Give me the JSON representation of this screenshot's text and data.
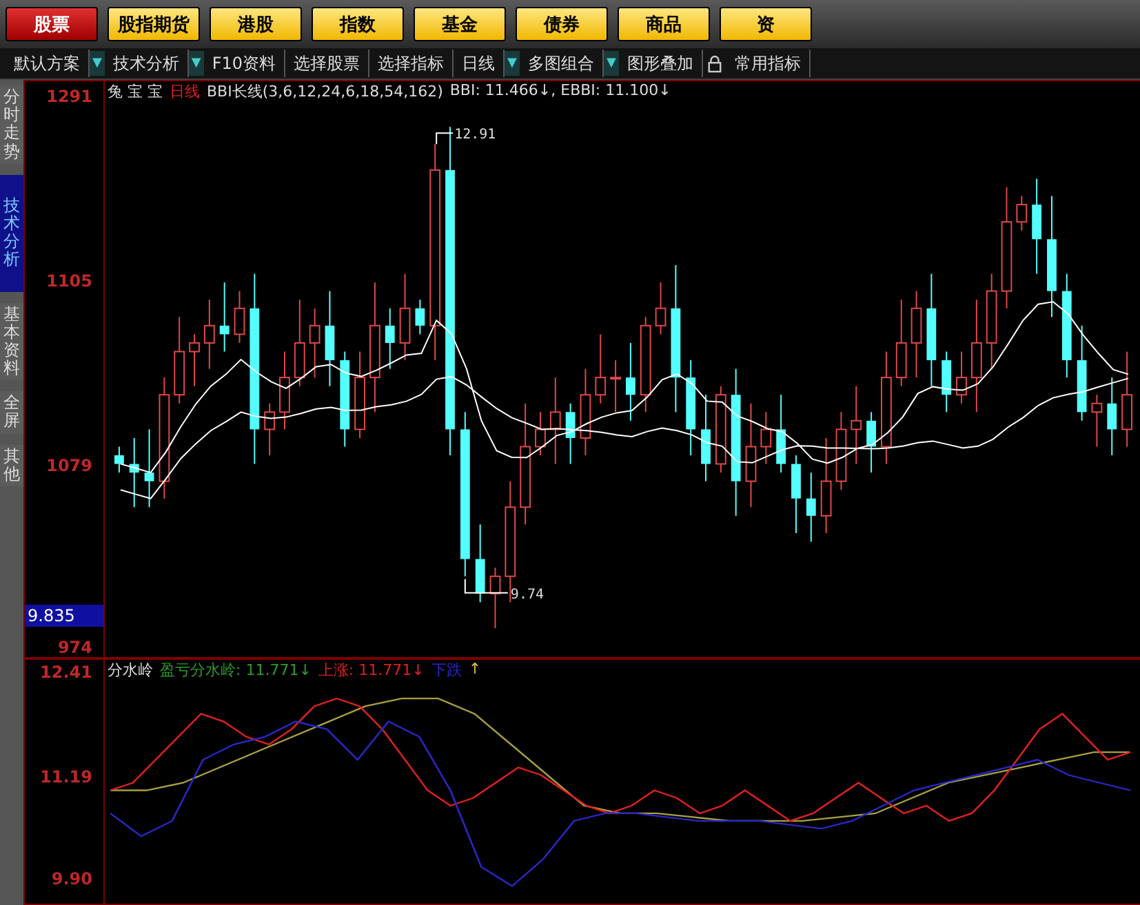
{
  "market_tabs": [
    {
      "label": "股票",
      "selected": true
    },
    {
      "label": "股指期货",
      "selected": false
    },
    {
      "label": "港股",
      "selected": false
    },
    {
      "label": "指数",
      "selected": false
    },
    {
      "label": "基金",
      "selected": false
    },
    {
      "label": "债券",
      "selected": false
    },
    {
      "label": "商品",
      "selected": false
    },
    {
      "label": "资",
      "selected": false
    }
  ],
  "toolbar": [
    {
      "kind": "dropdown",
      "label": "默认方案",
      "menu": "▼"
    },
    {
      "kind": "dropdown",
      "label": "技术分析",
      "menu": "▼"
    },
    {
      "kind": "button",
      "label": "F10资料"
    },
    {
      "kind": "button",
      "label": "选择股票"
    },
    {
      "kind": "button",
      "label": "选择指标"
    },
    {
      "kind": "dropdown",
      "label": "日线",
      "menu": "▼"
    },
    {
      "kind": "dropdown",
      "label": "多图组合",
      "menu": "▼"
    },
    {
      "kind": "button",
      "label": "图形叠加"
    },
    {
      "kind": "lock"
    },
    {
      "kind": "button",
      "label": "常用指标"
    }
  ],
  "side_tabs": [
    {
      "label": "分时走势",
      "selected": false
    },
    {
      "label": "技术分析",
      "selected": true
    },
    {
      "label": "基本资料",
      "selected": false
    },
    {
      "label": "全屏",
      "selected": false
    },
    {
      "label": "其他",
      "selected": false
    }
  ],
  "main_chart": {
    "stock_name": "兔 宝 宝",
    "period": "日线",
    "indicator": "BBI长线(3,6,12,24,6,18,54,162)",
    "readout": "BBI: 11.466↓, EBBI: 11.100↓",
    "y_labels": [
      "1291",
      "1105",
      "1079",
      "974"
    ],
    "current_price": "9.835",
    "high_marker": "12.91",
    "low_marker": "9.74"
  },
  "sub_chart": {
    "name": "分水岭",
    "legend": [
      {
        "label": "盈亏分水岭: 11.771↓",
        "color": "#2f9a2f"
      },
      {
        "label": "上涨: 11.771↓",
        "color": "#e02020"
      },
      {
        "label": "下跌",
        "color": "#2828c8"
      }
    ],
    "legend_arrow": "↑",
    "y_labels": [
      "12.41",
      "11.19",
      "9.90"
    ]
  }
}
